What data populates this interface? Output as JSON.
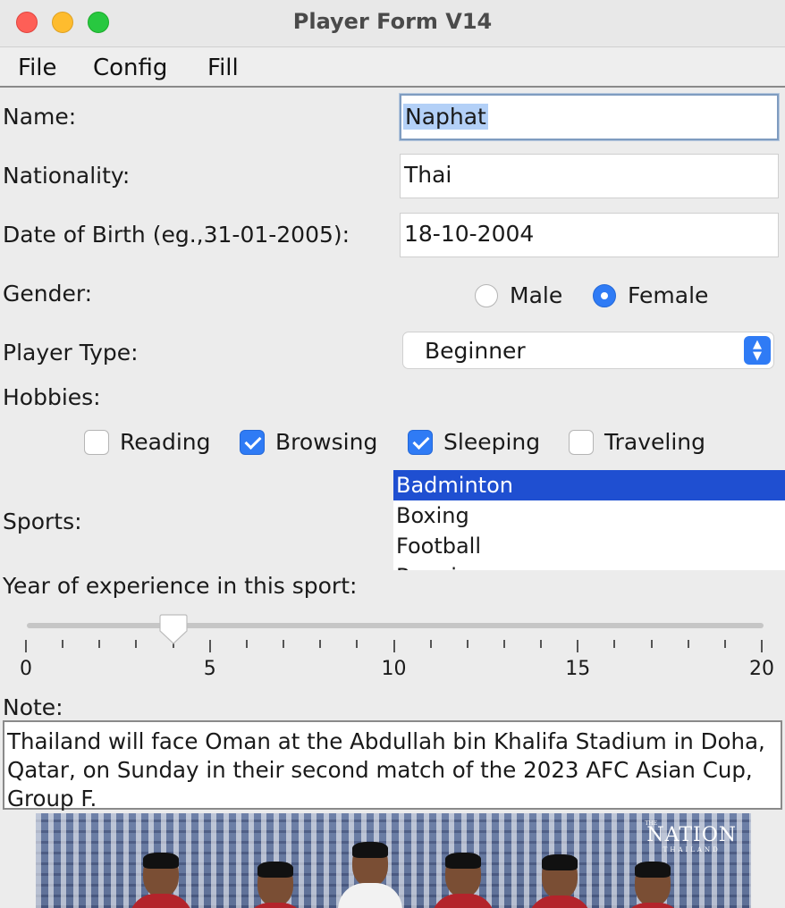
{
  "window": {
    "title": "Player Form V14"
  },
  "menu": [
    "File",
    "Config",
    "Fill"
  ],
  "form": {
    "name_label": "Name:",
    "name_value": "Naphat",
    "nationality_label": "Nationality:",
    "nationality_value": "Thai",
    "dob_label": "Date of Birth (eg.,31-01-2005):",
    "dob_value": "18-10-2004",
    "gender_label": "Gender:",
    "gender_options": [
      {
        "label": "Male",
        "selected": false
      },
      {
        "label": "Female",
        "selected": true
      }
    ],
    "player_type_label": "Player Type:",
    "player_type_value": "Beginner",
    "hobbies_label": "Hobbies:",
    "hobbies": [
      {
        "label": "Reading",
        "checked": false
      },
      {
        "label": "Browsing",
        "checked": true
      },
      {
        "label": "Sleeping",
        "checked": true
      },
      {
        "label": "Traveling",
        "checked": false
      }
    ],
    "sports_label": "Sports:",
    "sports": [
      {
        "label": "Badminton",
        "selected": true
      },
      {
        "label": "Boxing",
        "selected": false
      },
      {
        "label": "Football",
        "selected": false
      },
      {
        "label": "Running",
        "selected": false
      }
    ],
    "experience_label": "Year of experience in this sport:",
    "experience": {
      "min": 0,
      "max": 20,
      "value": 4,
      "labels": [
        "0",
        "5",
        "10",
        "15",
        "20"
      ]
    },
    "note_label": "Note:",
    "note_value": "Thailand will face Oman at the Abdullah bin Khalifa Stadium in Doha, Qatar, on Sunday in their second match of the 2023 AFC Asian Cup, Group F."
  },
  "photo": {
    "watermark_top": "THE",
    "watermark_main": "NATION",
    "watermark_sub": "THAILAND"
  }
}
